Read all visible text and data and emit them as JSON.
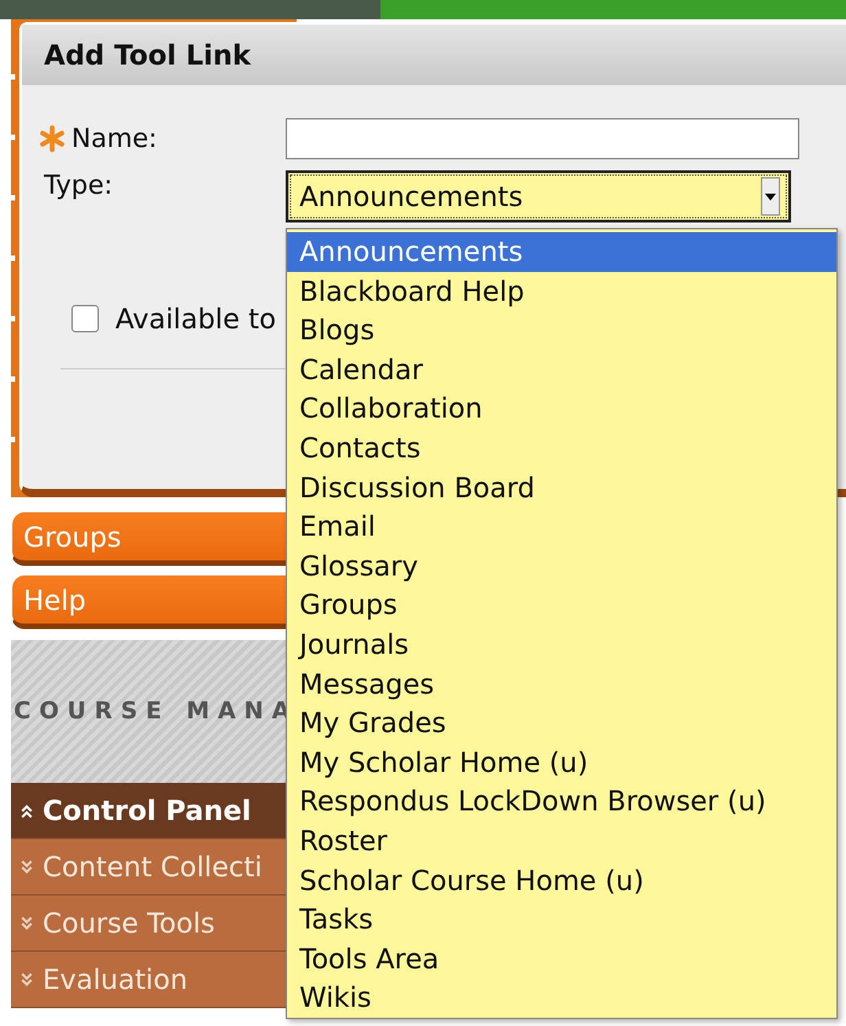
{
  "dialog": {
    "title": "Add Tool Link",
    "name_field": {
      "label": "Name:",
      "required": true
    },
    "type_field": {
      "label": "Type:",
      "value": "Announcements"
    },
    "checkbox": {
      "label": "Available to",
      "checked": false
    }
  },
  "dropdown": {
    "options": [
      {
        "label": "Announcements",
        "selected": true
      },
      {
        "label": "Blackboard Help",
        "selected": false
      },
      {
        "label": "Blogs",
        "selected": false
      },
      {
        "label": "Calendar",
        "selected": false
      },
      {
        "label": "Collaboration",
        "selected": false
      },
      {
        "label": "Contacts",
        "selected": false
      },
      {
        "label": "Discussion Board",
        "selected": false
      },
      {
        "label": "Email",
        "selected": false
      },
      {
        "label": "Glossary",
        "selected": false
      },
      {
        "label": "Groups",
        "selected": false
      },
      {
        "label": "Journals",
        "selected": false
      },
      {
        "label": "Messages",
        "selected": false
      },
      {
        "label": "My Grades",
        "selected": false
      },
      {
        "label": "My Scholar Home (u)",
        "selected": false
      },
      {
        "label": "Respondus LockDown Browser (u)",
        "selected": false
      },
      {
        "label": "Roster",
        "selected": false
      },
      {
        "label": "Scholar Course Home (u)",
        "selected": false
      },
      {
        "label": "Tasks",
        "selected": false
      },
      {
        "label": "Tools Area",
        "selected": false
      },
      {
        "label": "Wikis",
        "selected": false
      }
    ]
  },
  "sidebar": {
    "buttons": [
      "Groups",
      "Help"
    ],
    "section_heading": "COURSE MANA",
    "menu": [
      {
        "label": "Control Panel",
        "expanded": true
      },
      {
        "label": "Content Collecti",
        "expanded": false
      },
      {
        "label": "Course Tools",
        "expanded": false
      },
      {
        "label": "Evaluation",
        "expanded": false
      }
    ]
  }
}
